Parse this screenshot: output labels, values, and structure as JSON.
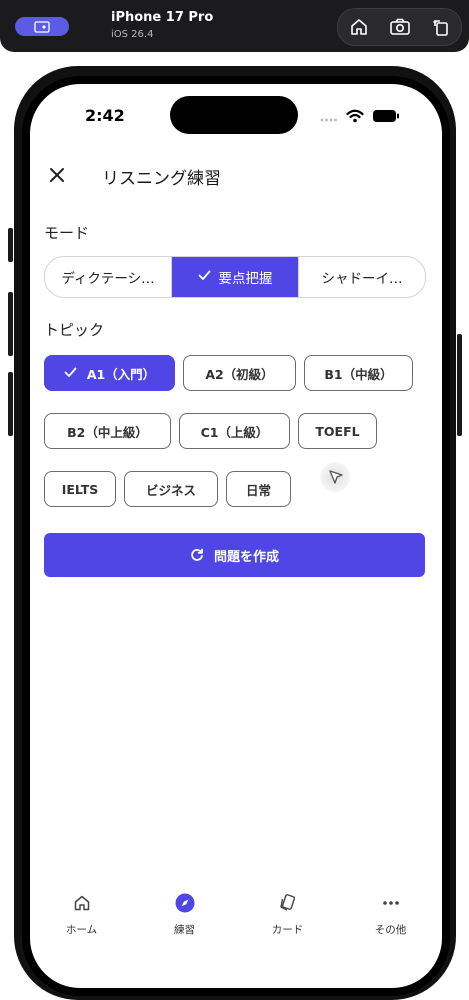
{
  "simulator": {
    "device_name": "iPhone 17 Pro",
    "os_version": "iOS 26.4",
    "icons": [
      "screen-icon",
      "home-icon",
      "camera-icon",
      "rotate-icon"
    ]
  },
  "status_bar": {
    "time": "2:42"
  },
  "header": {
    "title": "リスニング練習",
    "close_icon": "close-icon"
  },
  "mode": {
    "label": "モード",
    "options": [
      {
        "label": "ディクテーシ…",
        "selected": false
      },
      {
        "label": "要点把握",
        "selected": true
      },
      {
        "label": "シャドーイ…",
        "selected": false
      }
    ]
  },
  "topic": {
    "label": "トピック",
    "chips": [
      {
        "label": "A1（入門）",
        "selected": true
      },
      {
        "label": "A2（初級）",
        "selected": false
      },
      {
        "label": "B1（中級）",
        "selected": false
      },
      {
        "label": "B2（中上級）",
        "selected": false
      },
      {
        "label": "C1（上級）",
        "selected": false
      },
      {
        "label": "TOEFL",
        "selected": false
      },
      {
        "label": "IELTS",
        "selected": false
      },
      {
        "label": "ビジネス",
        "selected": false
      },
      {
        "label": "日常",
        "selected": false
      }
    ]
  },
  "generate_button": {
    "label": "問題を作成",
    "icon": "refresh-icon"
  },
  "tab_bar": {
    "tabs": [
      {
        "label": "ホーム",
        "icon": "home-icon",
        "active": false
      },
      {
        "label": "練習",
        "icon": "compass-icon",
        "active": true
      },
      {
        "label": "カード",
        "icon": "cards-icon",
        "active": false
      },
      {
        "label": "その他",
        "icon": "more-icon",
        "active": false
      }
    ]
  },
  "colors": {
    "accent": "#4f46e5",
    "border": "#6b6b70"
  }
}
